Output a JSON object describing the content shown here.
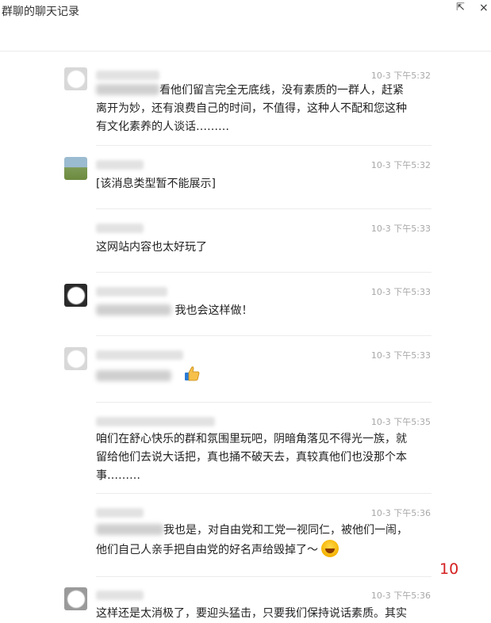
{
  "window": {
    "title": "群聊的聊天记录",
    "popout_glyph": "⇱",
    "close_glyph": "×"
  },
  "messages": [
    {
      "time": "10-3 下午5:32",
      "text_lines": [
        "看他们留言完全无底线，没有素质的一群人，赶紧",
        "离开为妙，还有浪费自己的时间，不值得，这种人不配和您这种",
        "有文化素养的人谈话………"
      ]
    },
    {
      "time": "10-3 下午5:32",
      "text": "[该消息类型暂不能展示]"
    },
    {
      "time": "10-3 下午5:33",
      "text": "这网站内容也太好玩了"
    },
    {
      "time": "10-3 下午5:33",
      "text": "我也会这样做！"
    },
    {
      "time": "10-3 下午5:33",
      "emoji": "thumbs-up"
    },
    {
      "time": "10-3 下午5:35",
      "text_lines": [
        "咱们在舒心快乐的群和氛围里玩吧，阴暗角落见不得光一族，就",
        "留给他们去说大话把，真也捅不破天去，真较真他们也没那个本",
        "事………"
      ]
    },
    {
      "time": "10-3 下午5:36",
      "text_lines": [
        "我也是，对自由党和工党一视同仁，被他们一闹，",
        "他们自己人亲手把自由党的好名声给毁掉了～"
      ]
    },
    {
      "time": "10-3 下午5:36",
      "text": "这样还是太消极了，要迎头猛击，只要我们保持说话素质。其实"
    }
  ],
  "annotation": {
    "page_number": "10",
    "color": "#d41f1f"
  }
}
